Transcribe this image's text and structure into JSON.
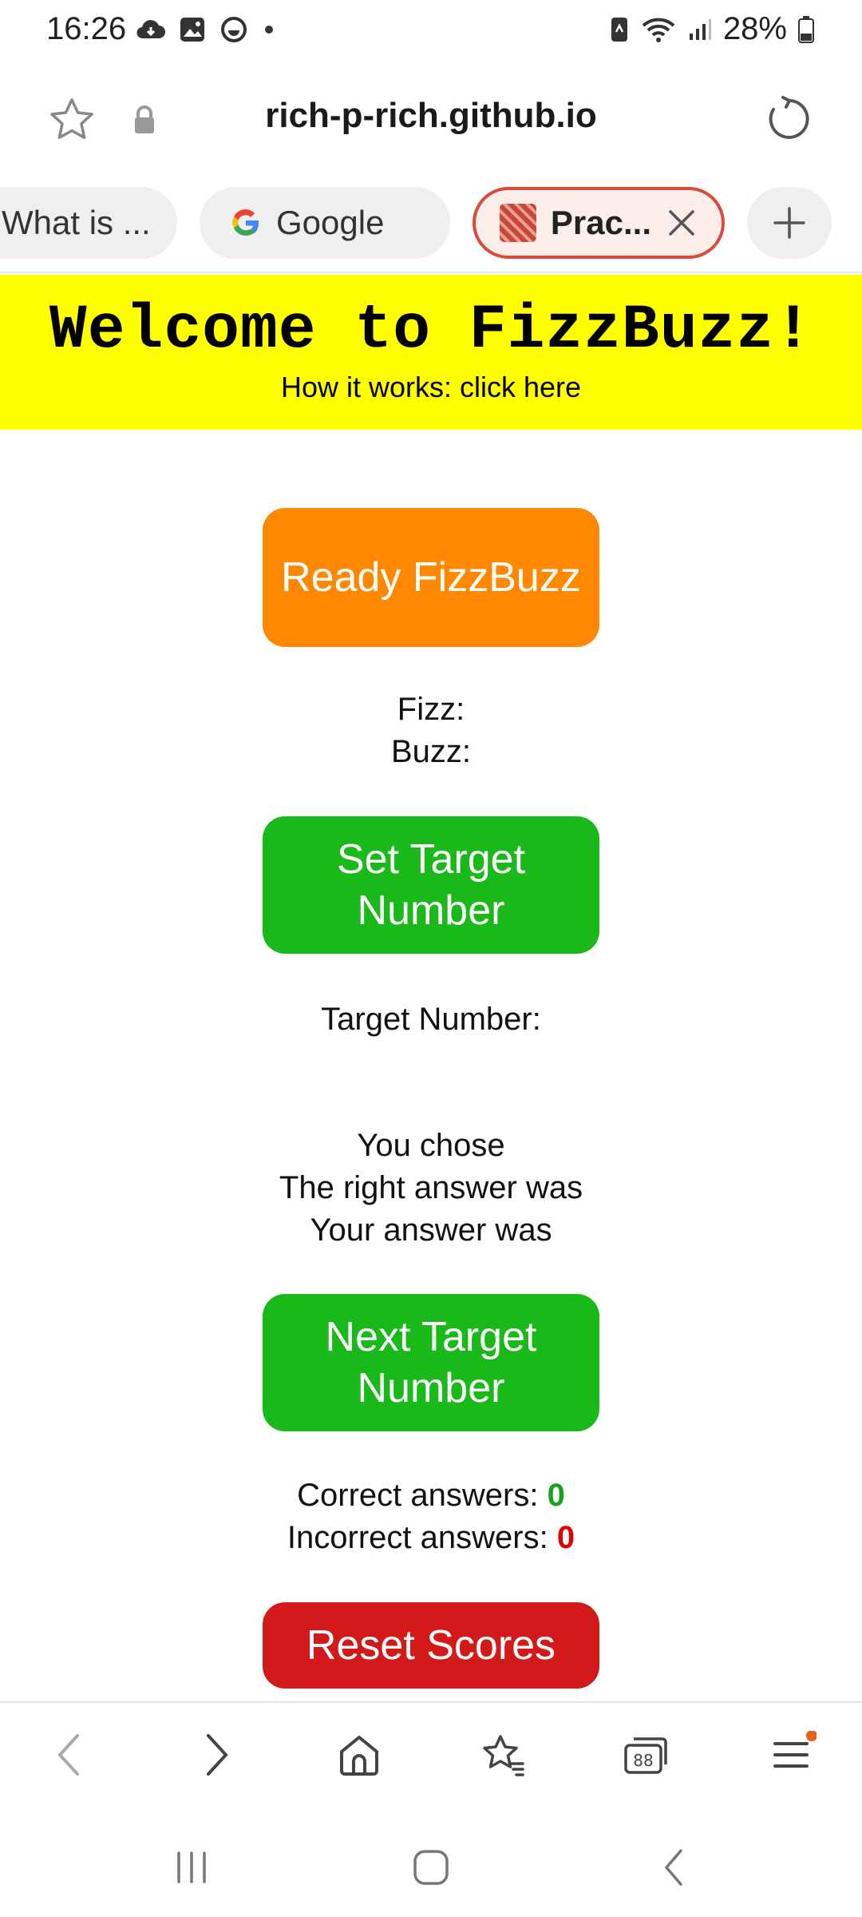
{
  "status_bar": {
    "time": "16:26",
    "battery": "28%",
    "icons": [
      "cloud-icon",
      "gallery-icon",
      "smiley-icon",
      "dot-icon",
      "nfc-icon",
      "wifi-icon",
      "signal-icon",
      "battery-icon"
    ]
  },
  "browser": {
    "url": "rich-p-rich.github.io",
    "tabs": [
      {
        "label": "What is ..."
      },
      {
        "label": "Google"
      },
      {
        "label": "Prac...",
        "active": true
      }
    ],
    "colors": {
      "active_tab_border": "#d94c3a",
      "notification_dot": "#e8611a"
    }
  },
  "page": {
    "title": "Welcome to FizzBuzz!",
    "how_it_works": "How it works: click here",
    "ready_button": "Ready FizzBuzz",
    "fizz_label": "Fizz:",
    "buzz_label": "Buzz:",
    "set_target_button": "Set Target Number",
    "target_label": "Target Number:",
    "you_chose": "You chose",
    "right_answer": "The right answer was",
    "your_answer": "Your answer was",
    "next_target_button": "Next Target Number",
    "correct_label": "Correct answers: ",
    "correct_count": "0",
    "incorrect_label": "Incorrect answers: ",
    "incorrect_count": "0",
    "reset_button": "Reset Scores",
    "colors": {
      "banner": "#ffff00",
      "ready": "#ff8800",
      "green_buttons": "#1ab91a",
      "reset": "#d31a1a",
      "correct": "#16a316",
      "incorrect": "#e00000"
    }
  }
}
